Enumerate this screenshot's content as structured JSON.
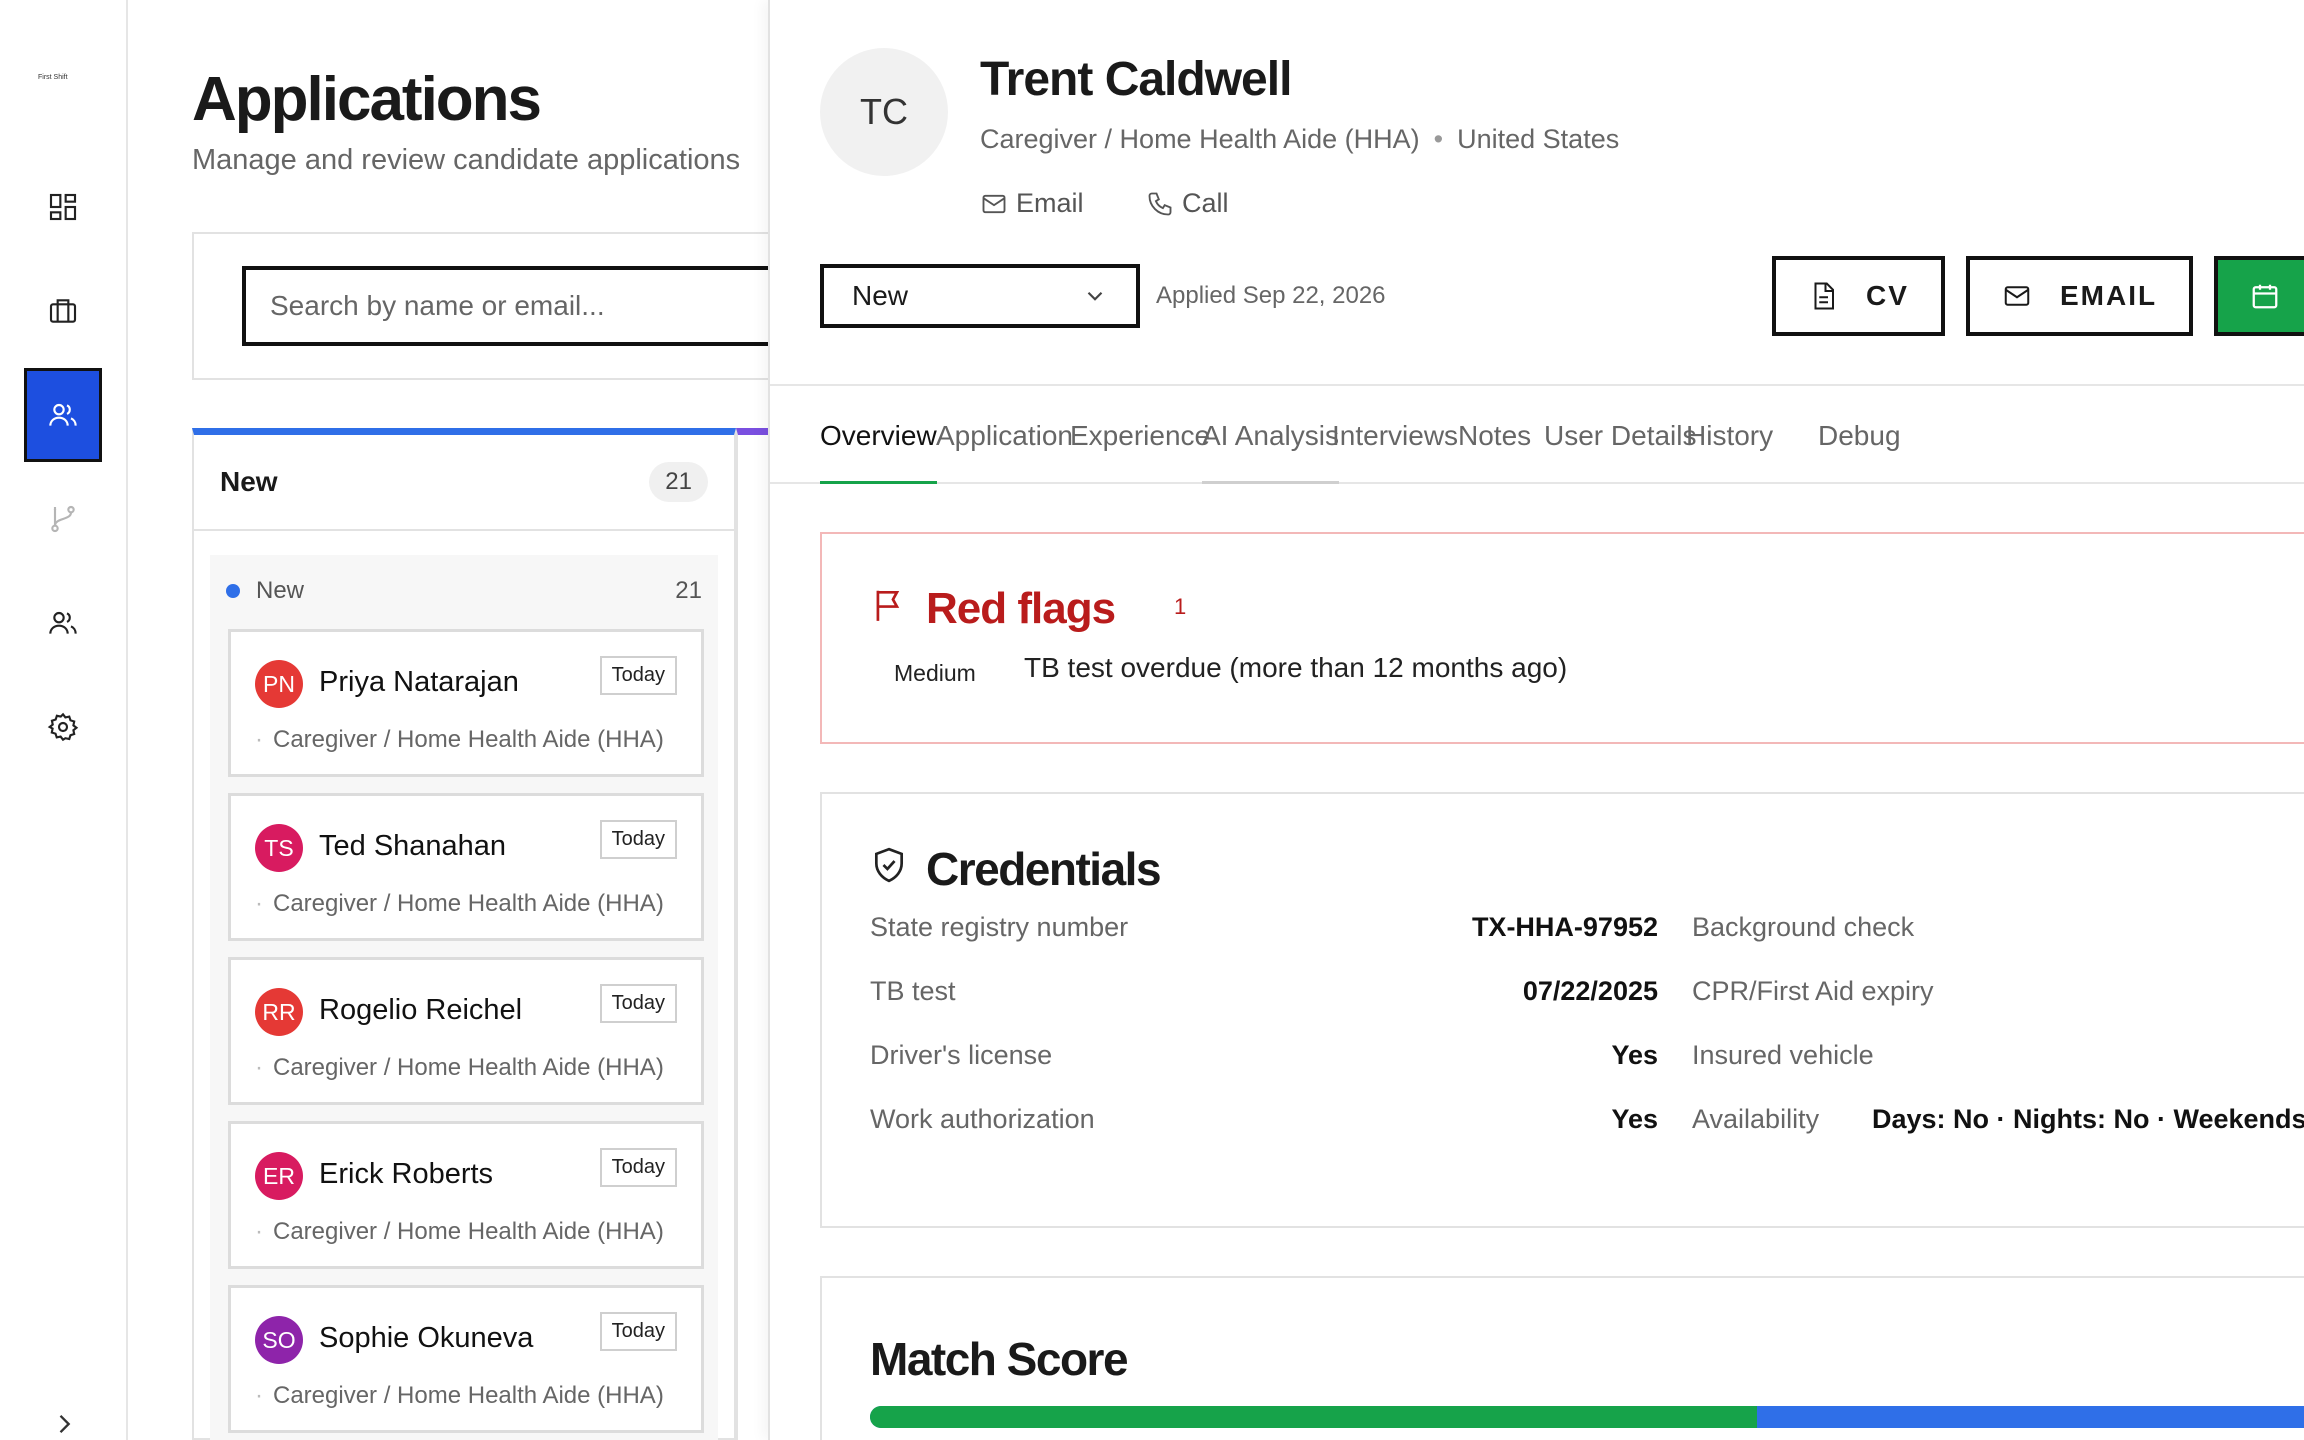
{
  "sidebar": {
    "logo_text": "First Shift",
    "items": [
      {
        "name": "dashboard",
        "icon": "dashboard-icon",
        "active": false
      },
      {
        "name": "jobs",
        "icon": "briefcase-icon",
        "active": false
      },
      {
        "name": "applications",
        "icon": "users-icon",
        "active": true
      },
      {
        "name": "pipeline",
        "icon": "git-branch-icon",
        "active": false
      },
      {
        "name": "team",
        "icon": "team-icon",
        "active": false
      },
      {
        "name": "settings",
        "icon": "gear-icon",
        "active": false
      }
    ],
    "expand_icon": "chevron-right-icon"
  },
  "page": {
    "title": "Applications",
    "subtitle": "Manage and review candidate applications"
  },
  "search": {
    "placeholder": "Search by name or email..."
  },
  "column": {
    "title": "New",
    "count": "21",
    "accent": "#2f6fe8",
    "group": {
      "label": "New",
      "count": "21"
    },
    "cards": [
      {
        "initials": "PN",
        "name": "Priya Natarajan",
        "badge": "Today",
        "role": "Caregiver / Home Health Aide (HHA)",
        "color": "#e53935"
      },
      {
        "initials": "TS",
        "name": "Ted Shanahan",
        "badge": "Today",
        "role": "Caregiver / Home Health Aide (HHA)",
        "color": "#d81b60"
      },
      {
        "initials": "RR",
        "name": "Rogelio Reichel",
        "badge": "Today",
        "role": "Caregiver / Home Health Aide (HHA)",
        "color": "#e53935"
      },
      {
        "initials": "ER",
        "name": "Erick Roberts",
        "badge": "Today",
        "role": "Caregiver / Home Health Aide (HHA)",
        "color": "#d81b60"
      },
      {
        "initials": "SO",
        "name": "Sophie Okuneva",
        "badge": "Today",
        "role": "Caregiver / Home Health Aide (HHA)",
        "color": "#8e24aa"
      }
    ]
  },
  "detail": {
    "initials": "TC",
    "name": "Trent Caldwell",
    "role": "Caregiver / Home Health Aide (HHA)",
    "separator": "•",
    "location": "United States",
    "email_label": "Email",
    "call_label": "Call",
    "status": "New",
    "applied": "Applied Sep 22, 2026",
    "buttons": {
      "cv": "CV",
      "email": "EMAIL"
    },
    "tabs": [
      "Overview",
      "Application",
      "Experience",
      "AI Analysis",
      "Interviews",
      "Notes",
      "User Details",
      "History",
      "Debug"
    ],
    "active_tab": "Overview",
    "red_flags": {
      "title": "Red flags",
      "count": "1",
      "severity": "Medium",
      "text": "TB test overdue (more than 12 months ago)"
    },
    "credentials": {
      "title": "Credentials",
      "rows": [
        {
          "label": "State registry number",
          "value": "TX-HHA-97952",
          "label2": "Background check",
          "value2": ""
        },
        {
          "label": "TB test",
          "value": "07/22/2025",
          "label2": "CPR/First Aid expiry",
          "value2": ""
        },
        {
          "label": "Driver's license",
          "value": "Yes",
          "label2": "Insured vehicle",
          "value2": ""
        },
        {
          "label": "Work authorization",
          "value": "Yes",
          "label2": "Availability",
          "value2": "Days: No · Nights: No · Weekends"
        }
      ]
    },
    "match_score": {
      "title": "Match Score",
      "fraction": 0.612
    }
  }
}
